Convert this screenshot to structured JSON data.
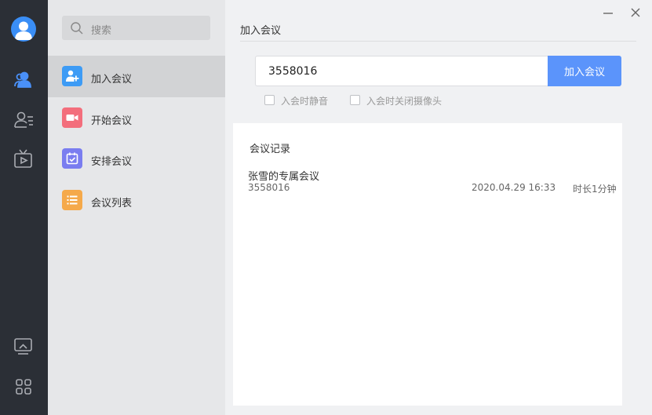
{
  "sidebar": {
    "icons": [
      "avatar",
      "contacts-group-icon",
      "contacts-list-icon",
      "tv-play-icon",
      "screen-share-icon",
      "apps-grid-icon"
    ]
  },
  "panel": {
    "search_placeholder": "搜索",
    "items": [
      {
        "label": "加入会议",
        "icon": "join-meeting-icon",
        "color": "#3d9bf5"
      },
      {
        "label": "开始会议",
        "icon": "start-meeting-icon",
        "color": "#f36e7c"
      },
      {
        "label": "安排会议",
        "icon": "schedule-meeting-icon",
        "color": "#7a7df0"
      },
      {
        "label": "会议列表",
        "icon": "meeting-list-icon",
        "color": "#f5a94a"
      }
    ]
  },
  "main": {
    "title": "加入会议",
    "meeting_code": "3558016",
    "join_button": "加入会议",
    "options": [
      {
        "label": "入会时静音",
        "checked": false
      },
      {
        "label": "入会时关闭摄像头",
        "checked": false
      }
    ],
    "records": {
      "title": "会议记录",
      "items": [
        {
          "name": "张雪的专属会议",
          "code": "3558016",
          "time": "2020.04.29 16:33",
          "duration": "时长1分钟"
        }
      ]
    }
  },
  "colors": {
    "rail_bg": "#2b2f36",
    "accent": "#5b94fb"
  }
}
